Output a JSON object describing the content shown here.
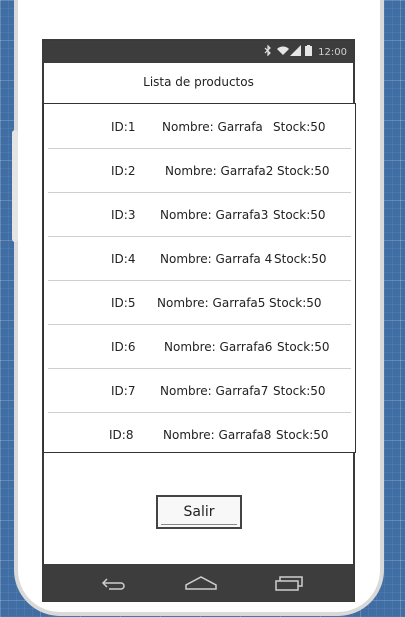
{
  "status_bar": {
    "icons": [
      "bluetooth-icon",
      "wifi-icon",
      "signal-icon",
      "battery-icon"
    ],
    "time": "12:00"
  },
  "screen_title": "Lista de productos",
  "products": [
    {
      "id": "ID:1",
      "name": "Nombre: Garrafa",
      "stock": "Stock:50"
    },
    {
      "id": "ID:2",
      "name": "Nombre: Garrafa2",
      "stock": "Stock:50"
    },
    {
      "id": "ID:3",
      "name": "Nombre: Garrafa3",
      "stock": "Stock:50"
    },
    {
      "id": "ID:4",
      "name": "Nombre: Garrafa 4",
      "stock": "Stock:50"
    },
    {
      "id": "ID:5",
      "name": "Nombre: Garrafa5",
      "stock": "Stock:50"
    },
    {
      "id": "ID:6",
      "name": "Nombre: Garrafa6",
      "stock": "Stock:50"
    },
    {
      "id": "ID:7",
      "name": "Nombre: Garrafa7",
      "stock": "Stock:50"
    },
    {
      "id": "ID:8",
      "name": "Nombre: Garrafa8",
      "stock": "Stock:50"
    }
  ],
  "exit_button_label": "Salir",
  "nav_bar": {
    "icons": [
      "back-icon",
      "home-icon",
      "recent-apps-icon"
    ]
  },
  "colors": {
    "background": "#3f6da4",
    "bars": "#3d3d3d",
    "phone_body": "#ffffff"
  }
}
